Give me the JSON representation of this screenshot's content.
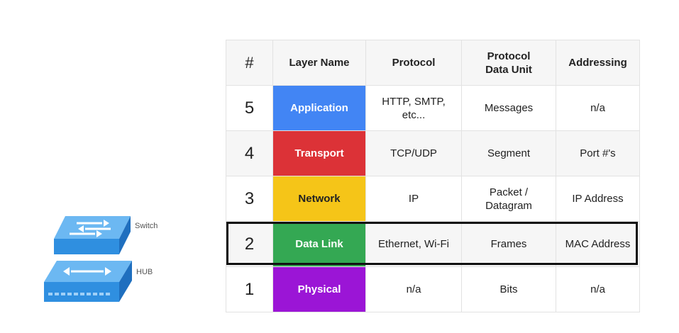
{
  "devices": {
    "switch_label": "Switch",
    "hub_label": "HUB"
  },
  "table": {
    "headers": [
      "#",
      "Layer Name",
      "Protocol",
      "Protocol\nData Unit",
      "Addressing"
    ],
    "rows": [
      {
        "num": "5",
        "layer": "Application",
        "color": "#4285f4",
        "protocol": "HTTP, SMTP,\netc...",
        "pdu": "Messages",
        "addressing": "n/a"
      },
      {
        "num": "4",
        "layer": "Transport",
        "color": "#dc3237",
        "protocol": "TCP/UDP",
        "pdu": "Segment",
        "addressing": "Port #'s"
      },
      {
        "num": "3",
        "layer": "Network",
        "color": "#f5c518",
        "protocol": "IP",
        "pdu": "Packet /\nDatagram",
        "addressing": "IP Address"
      },
      {
        "num": "2",
        "layer": "Data Link",
        "color": "#34a853",
        "protocol": "Ethernet, Wi-Fi",
        "pdu": "Frames",
        "addressing": "MAC Address"
      },
      {
        "num": "1",
        "layer": "Physical",
        "color": "#9b15d6",
        "protocol": "n/a",
        "pdu": "Bits",
        "addressing": "n/a"
      }
    ]
  },
  "highlight_row": "2",
  "layer_text_colors": {
    "Network": "#222222"
  }
}
